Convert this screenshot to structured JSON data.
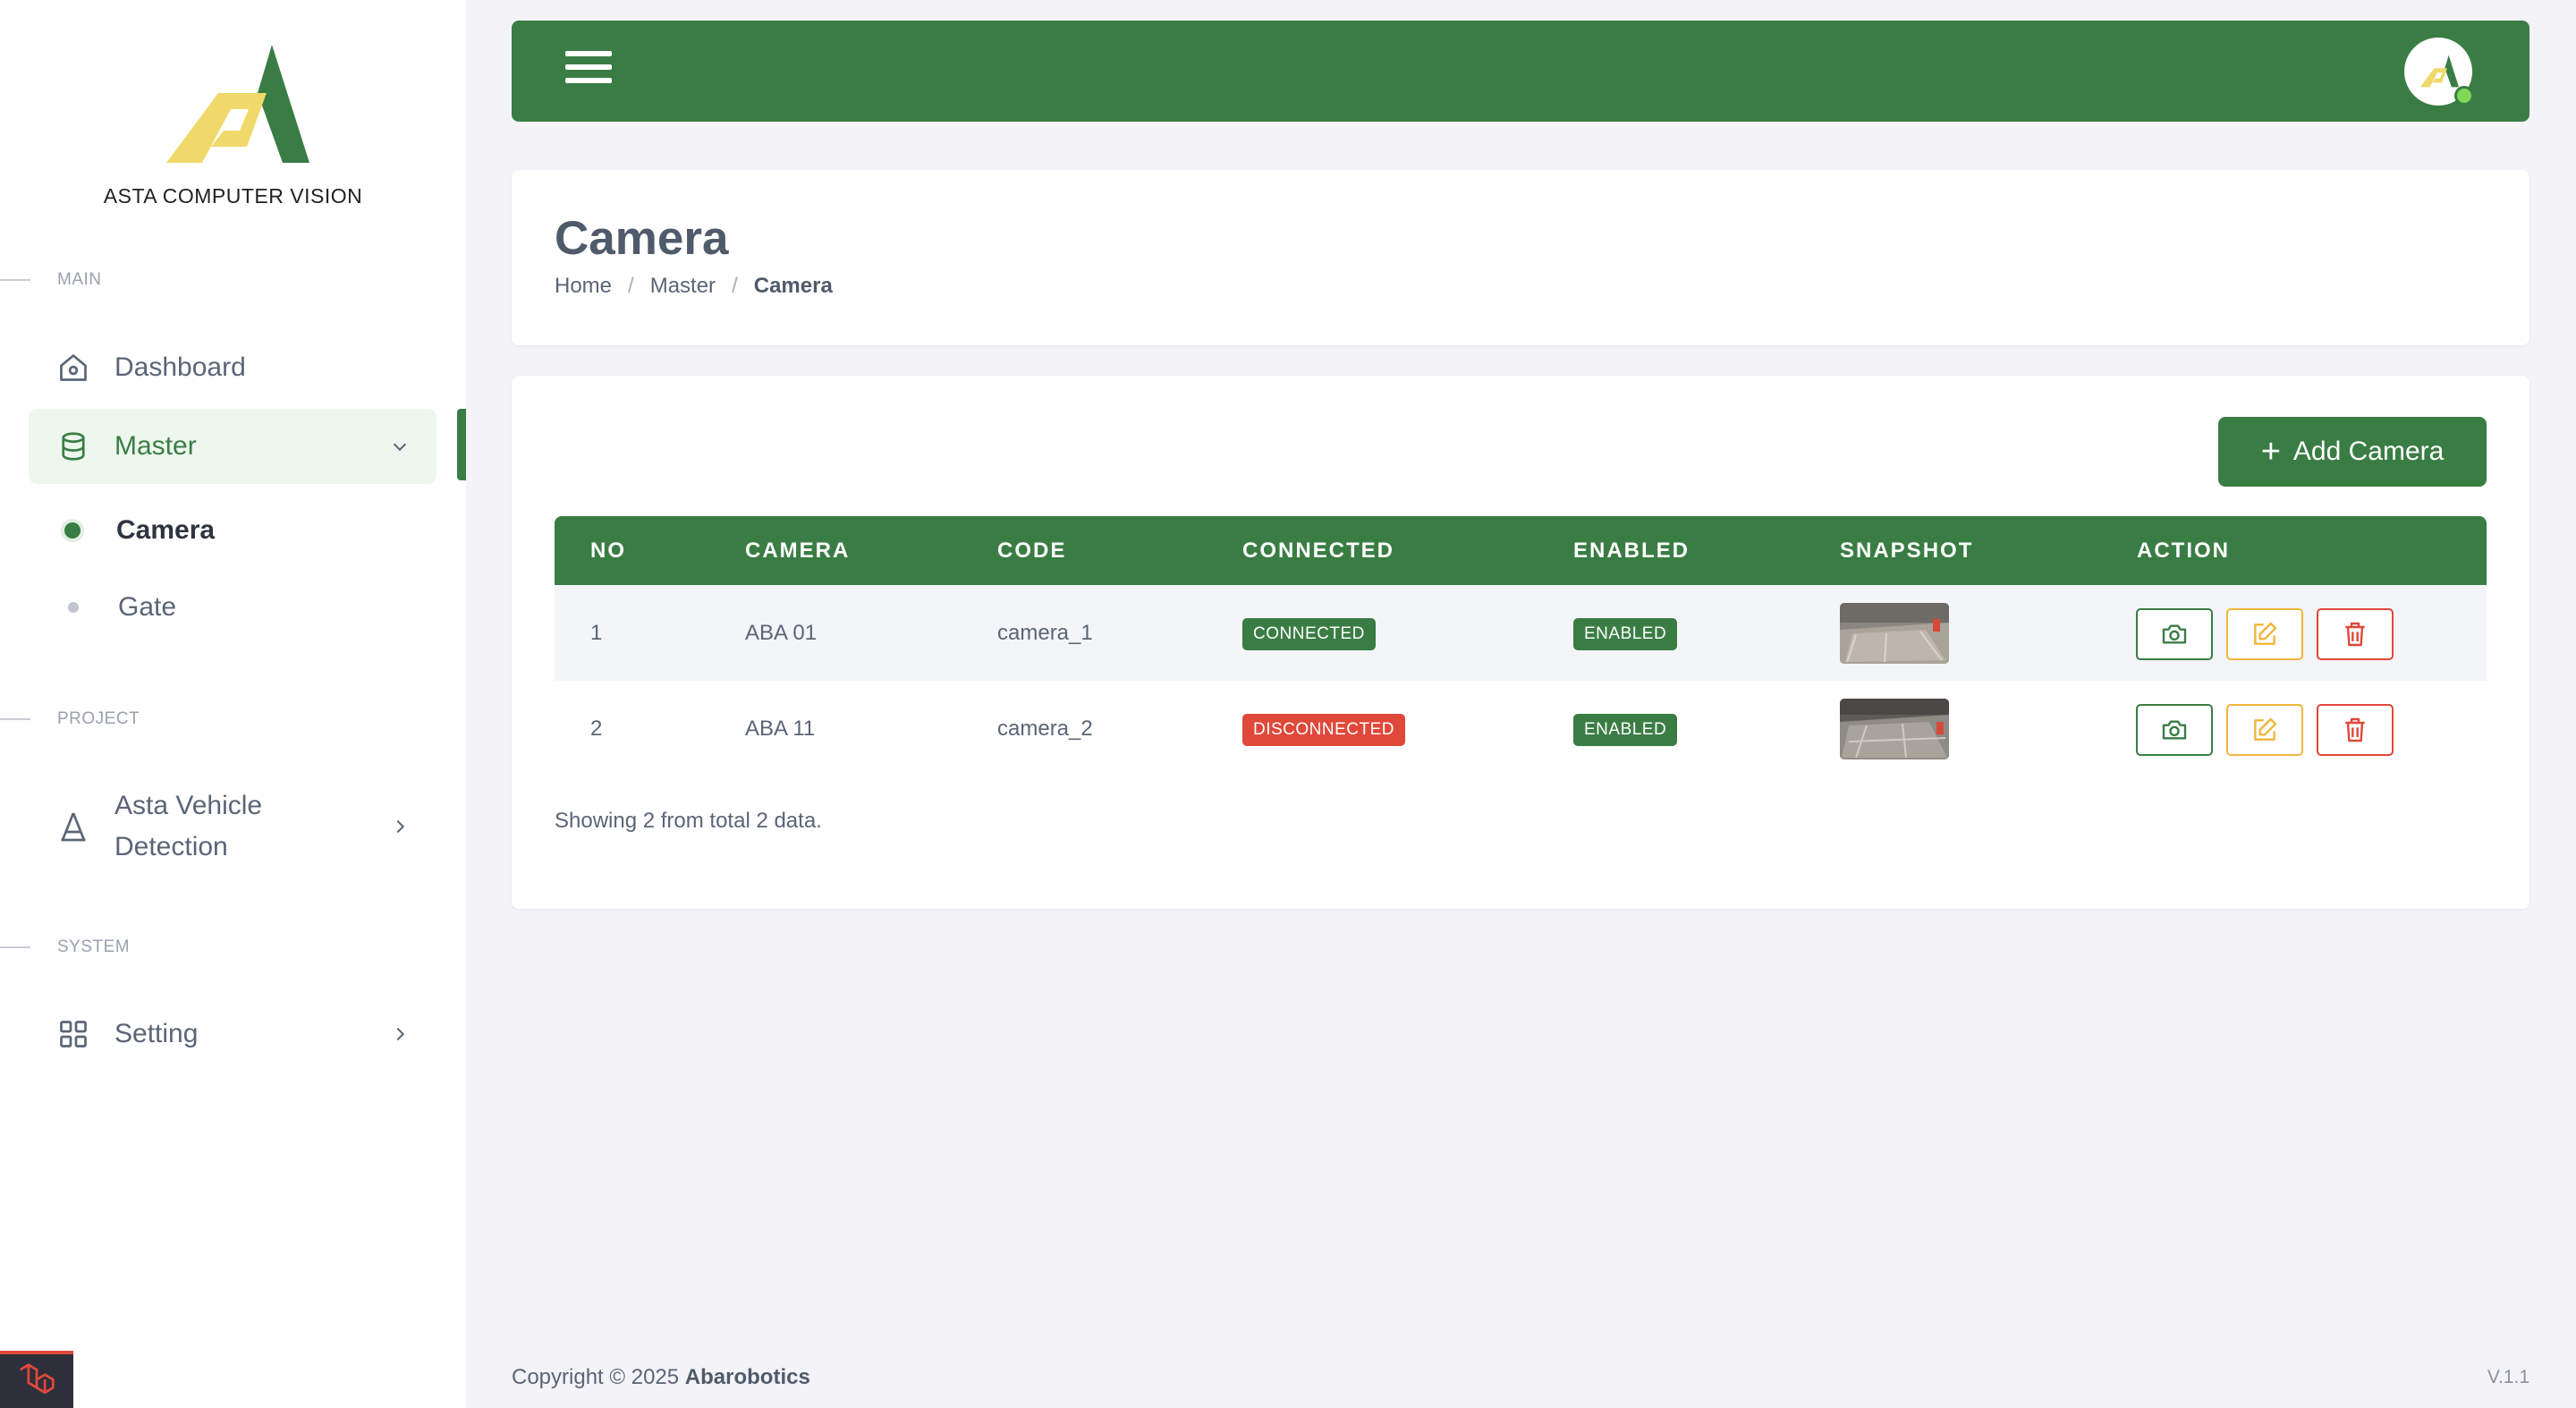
{
  "brand": {
    "name": "ASTA COMPUTER VISION"
  },
  "sidebar": {
    "sections": [
      {
        "label": "MAIN"
      },
      {
        "label": "PROJECT"
      },
      {
        "label": "SYSTEM"
      }
    ],
    "items": [
      {
        "label": "Dashboard",
        "icon": "home-icon"
      },
      {
        "label": "Master",
        "icon": "database-icon",
        "expanded": true,
        "active": true
      },
      {
        "label": "Asta Vehicle Detection",
        "line1": "Asta Vehicle",
        "line2": "Detection",
        "icon": "asta-icon"
      },
      {
        "label": "Setting",
        "icon": "grid-icon"
      }
    ],
    "master_children": [
      {
        "label": "Camera",
        "current": true
      },
      {
        "label": "Gate"
      }
    ]
  },
  "header": {
    "menu_icon": "hamburger-icon",
    "avatar": "user-avatar"
  },
  "page": {
    "title": "Camera",
    "breadcrumb": [
      "Home",
      "Master",
      "Camera"
    ]
  },
  "table": {
    "add_button": "Add Camera",
    "columns": [
      "NO",
      "CAMERA",
      "CODE",
      "CONNECTED",
      "ENABLED",
      "SNAPSHOT",
      "ACTION"
    ],
    "rows": [
      {
        "no": "1",
        "camera": "ABA 01",
        "code": "camera_1",
        "connected": "CONNECTED",
        "connected_status": "ok",
        "enabled": "ENABLED"
      },
      {
        "no": "2",
        "camera": "ABA 11",
        "code": "camera_2",
        "connected": "DISCONNECTED",
        "connected_status": "error",
        "enabled": "ENABLED"
      }
    ],
    "summary": "Showing 2 from total 2 data."
  },
  "footer": {
    "copyright_prefix": "Copyright © 2025",
    "company": "Abarobotics",
    "version": "V.1.1"
  },
  "colors": {
    "primary": "#3a7d44",
    "danger": "#e0483a",
    "warning": "#f2b53a",
    "logo_yellow": "#f0d96a"
  }
}
